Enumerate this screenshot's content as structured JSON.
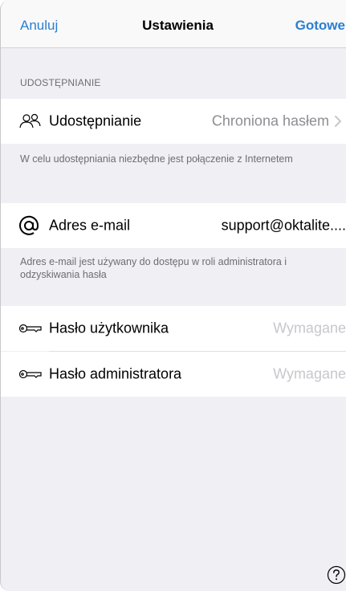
{
  "navbar": {
    "cancel_label": "Anuluj",
    "title": "Ustawienia",
    "done_label": "Gotowe"
  },
  "sharing_section": {
    "header": "UDOSTĘPNIANIE",
    "row": {
      "icon": "users-icon",
      "label": "Udostępnianie",
      "value": "Chroniona hasłem"
    },
    "footer": "W celu udostępniania niezbędne jest połączenie z Internetem"
  },
  "email_section": {
    "row": {
      "icon": "at-icon",
      "label": "Adres e-mail",
      "value": "support@oktalite...."
    },
    "footer": "Adres e-mail jest używany do dostępu w roli administratora i odzyskiwania hasła"
  },
  "password_section": {
    "rows": [
      {
        "icon": "key-icon",
        "label": "Hasło użytkownika",
        "value": "Wymagane"
      },
      {
        "icon": "key-icon",
        "label": "Hasło administratora",
        "value": "Wymagane"
      }
    ]
  },
  "help_icon": "help-icon",
  "colors": {
    "accent": "#2a7fd0",
    "background": "#efeff4",
    "secondary_text": "#8e8e93",
    "placeholder_text": "#c7c7cc"
  }
}
